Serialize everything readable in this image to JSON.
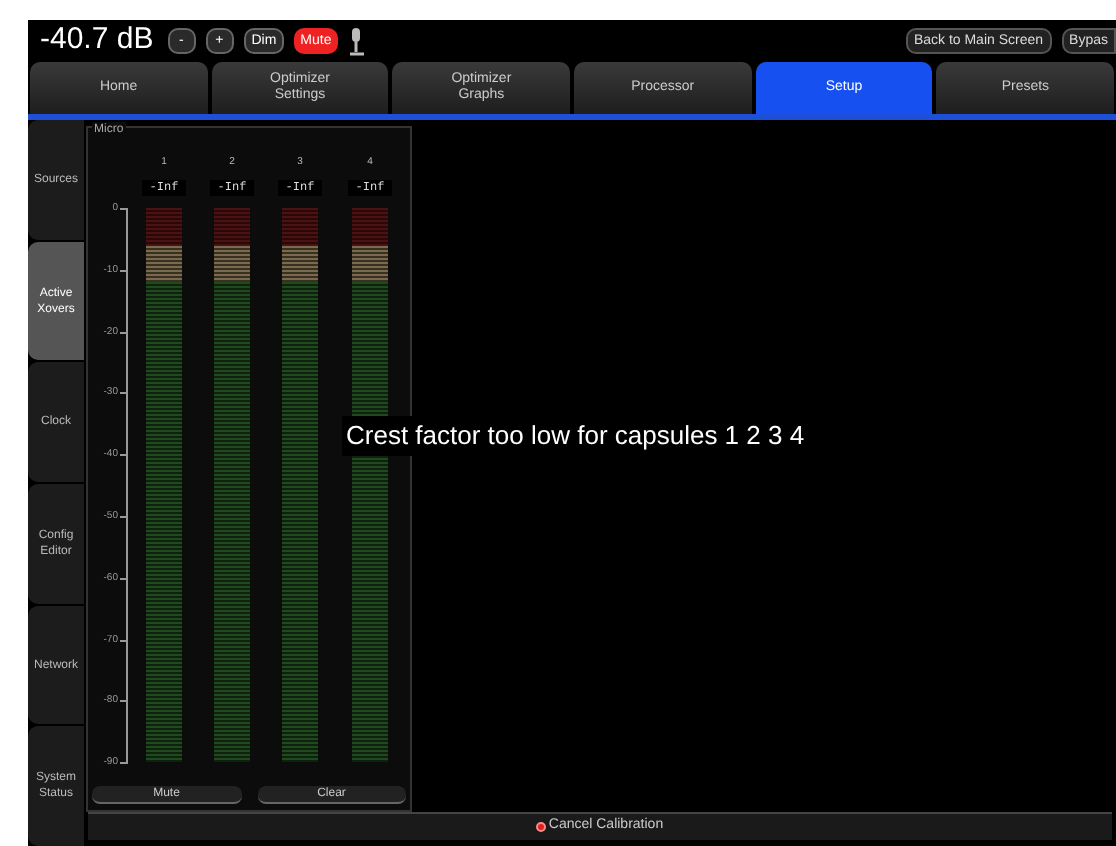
{
  "top_bar": {
    "volume": "-40.7 dB",
    "buttons": [
      {
        "label": "-",
        "kind": "small"
      },
      {
        "label": "+",
        "kind": "small"
      },
      {
        "label": "Dim",
        "kind": "small"
      },
      {
        "label": "Mute",
        "kind": "alert"
      }
    ],
    "right_buttons": [
      "Back to Main Screen",
      "Bypas"
    ]
  },
  "tabs": [
    {
      "label": "Home",
      "selected": false
    },
    {
      "label": "Optimizer\nSettings",
      "selected": false
    },
    {
      "label": "Optimizer\nGraphs",
      "selected": false
    },
    {
      "label": "Processor",
      "selected": false
    },
    {
      "label": "Setup",
      "selected": true
    },
    {
      "label": "Presets",
      "selected": false
    }
  ],
  "sidebar": {
    "items": [
      {
        "label": "Sources",
        "selected": false
      },
      {
        "label": "Active\nXovers",
        "selected": true
      },
      {
        "label": "Clock",
        "selected": false
      },
      {
        "label": "Config\nEditor",
        "selected": false
      },
      {
        "label": "Network",
        "selected": false
      },
      {
        "label": "System\nStatus",
        "selected": false
      }
    ]
  },
  "meter_panel": {
    "title": "Micro",
    "scale": [
      "0",
      "-10",
      "-20",
      "-30",
      "-40",
      "-50",
      "-60",
      "-70",
      "-80",
      "-90"
    ],
    "channels": [
      {
        "number": "1",
        "reading": "-Inf"
      },
      {
        "number": "2",
        "reading": "-Inf"
      },
      {
        "number": "3",
        "reading": "-Inf"
      },
      {
        "number": "4",
        "reading": "-Inf"
      }
    ],
    "buttons": [
      "Mute",
      "Clear"
    ]
  },
  "message": "Crest factor too low for capsules 1 2 3 4",
  "status_bar": {
    "action": "Cancel Calibration"
  }
}
